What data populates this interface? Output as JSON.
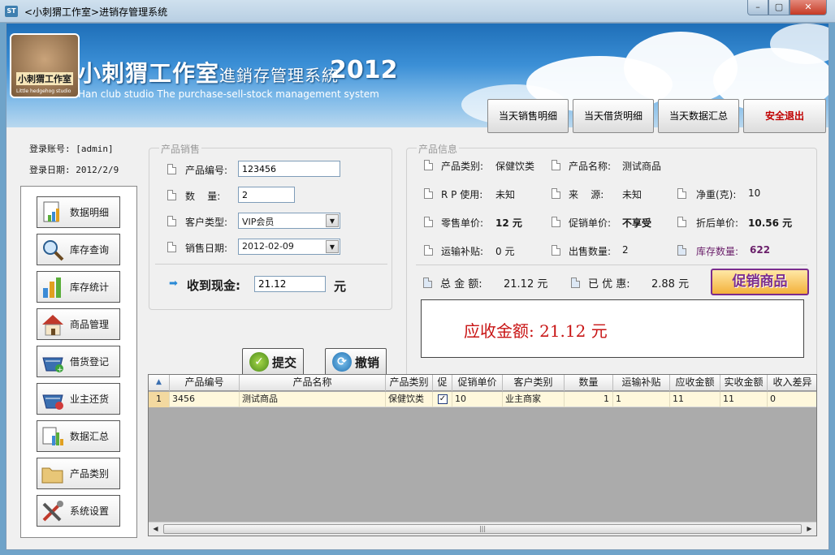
{
  "window": {
    "title": "<小刺猬工作室>进销存管理系统",
    "icon_text": "ST",
    "min_glyph": "–",
    "max_glyph": "▢",
    "close_glyph": "✕"
  },
  "banner": {
    "logo_text": "小刺猬工作室",
    "logo_subtext": "Little hedgehog studio",
    "brand_main": "小刺猬工作室",
    "brand_sys": "進銷存管理系統",
    "brand_year": "2012",
    "brand_en": "Han club studio The purchase-sell-stock management system"
  },
  "top_buttons": [
    "当天销售明细",
    "当天借货明细",
    "当天数据汇总",
    "安全退出"
  ],
  "login": {
    "account": "登录账号: [admin]",
    "date": "登录日期: 2012/2/9"
  },
  "menu": [
    {
      "label": "数据明细",
      "icon": "document-chart-icon"
    },
    {
      "label": "库存查询",
      "icon": "magnifier-icon"
    },
    {
      "label": "库存统计",
      "icon": "bar-chart-icon"
    },
    {
      "label": "商品管理",
      "icon": "house-icon"
    },
    {
      "label": "借货登记",
      "icon": "basket-add-icon"
    },
    {
      "label": "业主还货",
      "icon": "basket-return-icon"
    },
    {
      "label": "数据汇总",
      "icon": "summary-icon"
    },
    {
      "label": "产品类别",
      "icon": "folder-icon"
    },
    {
      "label": "系统设置",
      "icon": "tools-icon"
    }
  ],
  "sales": {
    "group_title": "产品销售",
    "code_label": "产品编号:",
    "code_value": "123456",
    "qty_label": "数    量:",
    "qty_value": "2",
    "customer_label": "客户类型:",
    "customer_value": "VIP会员",
    "date_label": "销售日期:",
    "date_value": "2012-02-09",
    "cash_label": "收到现金:",
    "cash_value": "21.12",
    "cash_unit": "元",
    "arrow_glyph": "➡"
  },
  "actions": {
    "submit": "提交",
    "cancel": "撤销",
    "submit_glyph": "✓",
    "cancel_glyph": "⟳"
  },
  "info": {
    "group_title": "产品信息",
    "category_label": "产品类别:",
    "category_value": "保健饮类",
    "name_label": "产品名称:",
    "name_value": "测试商品",
    "rp_label": "R P 使用:",
    "rp_value": "未知",
    "source_label": "来    源:",
    "source_value": "未知",
    "weight_label": "净重(克):",
    "weight_value": "10",
    "retail_label": "零售单价:",
    "retail_value": "12 元",
    "promo_label": "促销单价:",
    "promo_value": "不享受",
    "discount_label": "折后单价:",
    "discount_value": "10.56 元",
    "ship_label": "运输补贴:",
    "ship_value": "0 元",
    "sold_label": "出售数量:",
    "sold_value": "2",
    "stock_label": "库存数量:",
    "stock_value": "622",
    "total_label": "总 金 额:",
    "total_value": "21.12 元",
    "saved_label": "已 优 惠:",
    "saved_value": "2.88 元",
    "promo_badge": "促销商品",
    "due_label": "应收金额: 21.12 元"
  },
  "grid": {
    "sort_glyph": "▲",
    "headers": [
      "产品编号",
      "产品名称",
      "产品类别",
      "促",
      "促销单价",
      "客户类别",
      "数量",
      "运输补贴",
      "应收金额",
      "实收金额",
      "收入差异"
    ],
    "rows": [
      {
        "num": "1",
        "cells": [
          "3456",
          "测试商品",
          "保健饮类",
          "",
          "10",
          "业主商家",
          "1",
          "1",
          "11",
          "11",
          "0"
        ],
        "promo_checked": "✓"
      }
    ],
    "scroll_left": "◀",
    "scroll_right": "▶",
    "scroll_grip": "|||"
  }
}
